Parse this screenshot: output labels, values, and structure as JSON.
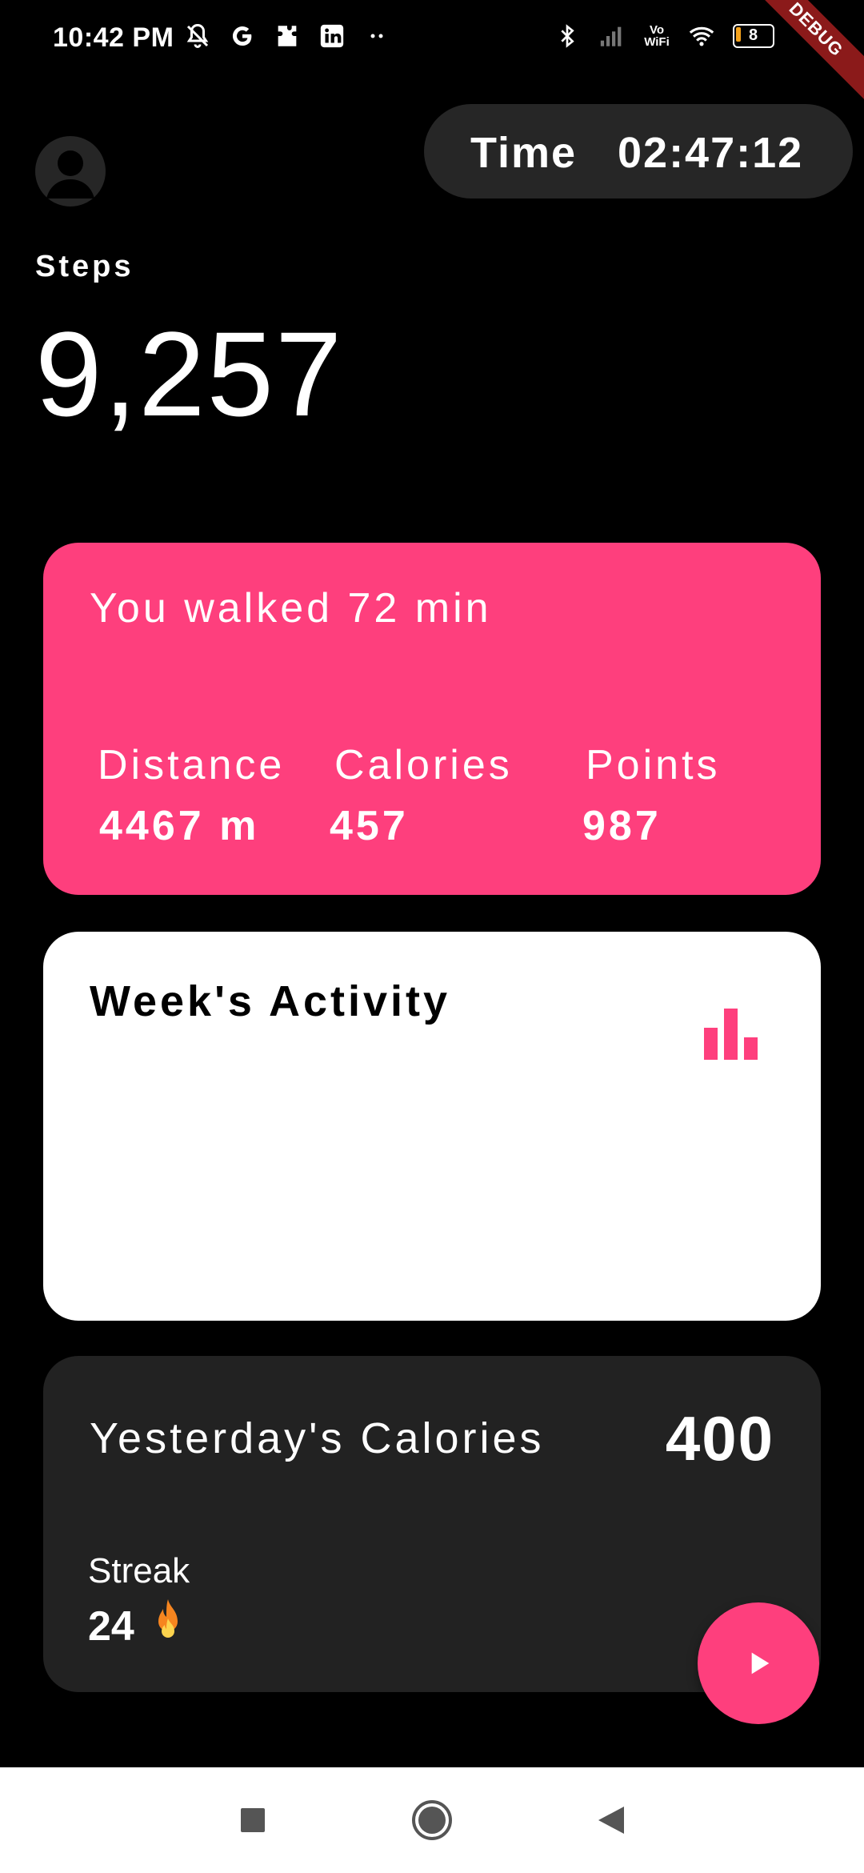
{
  "status_bar": {
    "time": "10:42 PM",
    "debug_label": "DEBUG",
    "vowifi_label": "Vo WiFi",
    "battery_level": "8"
  },
  "header": {
    "time_label": "Time",
    "time_value": "02:47:12"
  },
  "steps": {
    "label": "Steps",
    "value": "9,257"
  },
  "walk_card": {
    "title": "You walked 72 min",
    "stats": [
      {
        "label": "Distance",
        "value": "4467 m"
      },
      {
        "label": "Calories",
        "value": "457"
      },
      {
        "label": "Points",
        "value": "987"
      }
    ]
  },
  "week_card": {
    "title": "Week's Activity",
    "icon": "bar-chart-icon"
  },
  "calories_card": {
    "label": "Yesterday's Calories",
    "value": "400",
    "streak_label": "Streak",
    "streak_value": "24",
    "streak_icon": "🔥"
  },
  "fab": {
    "icon": "play-icon"
  },
  "colors": {
    "accent": "#fe3f7d",
    "background": "#000000",
    "card_dark": "#222222",
    "card_white": "#ffffff"
  }
}
